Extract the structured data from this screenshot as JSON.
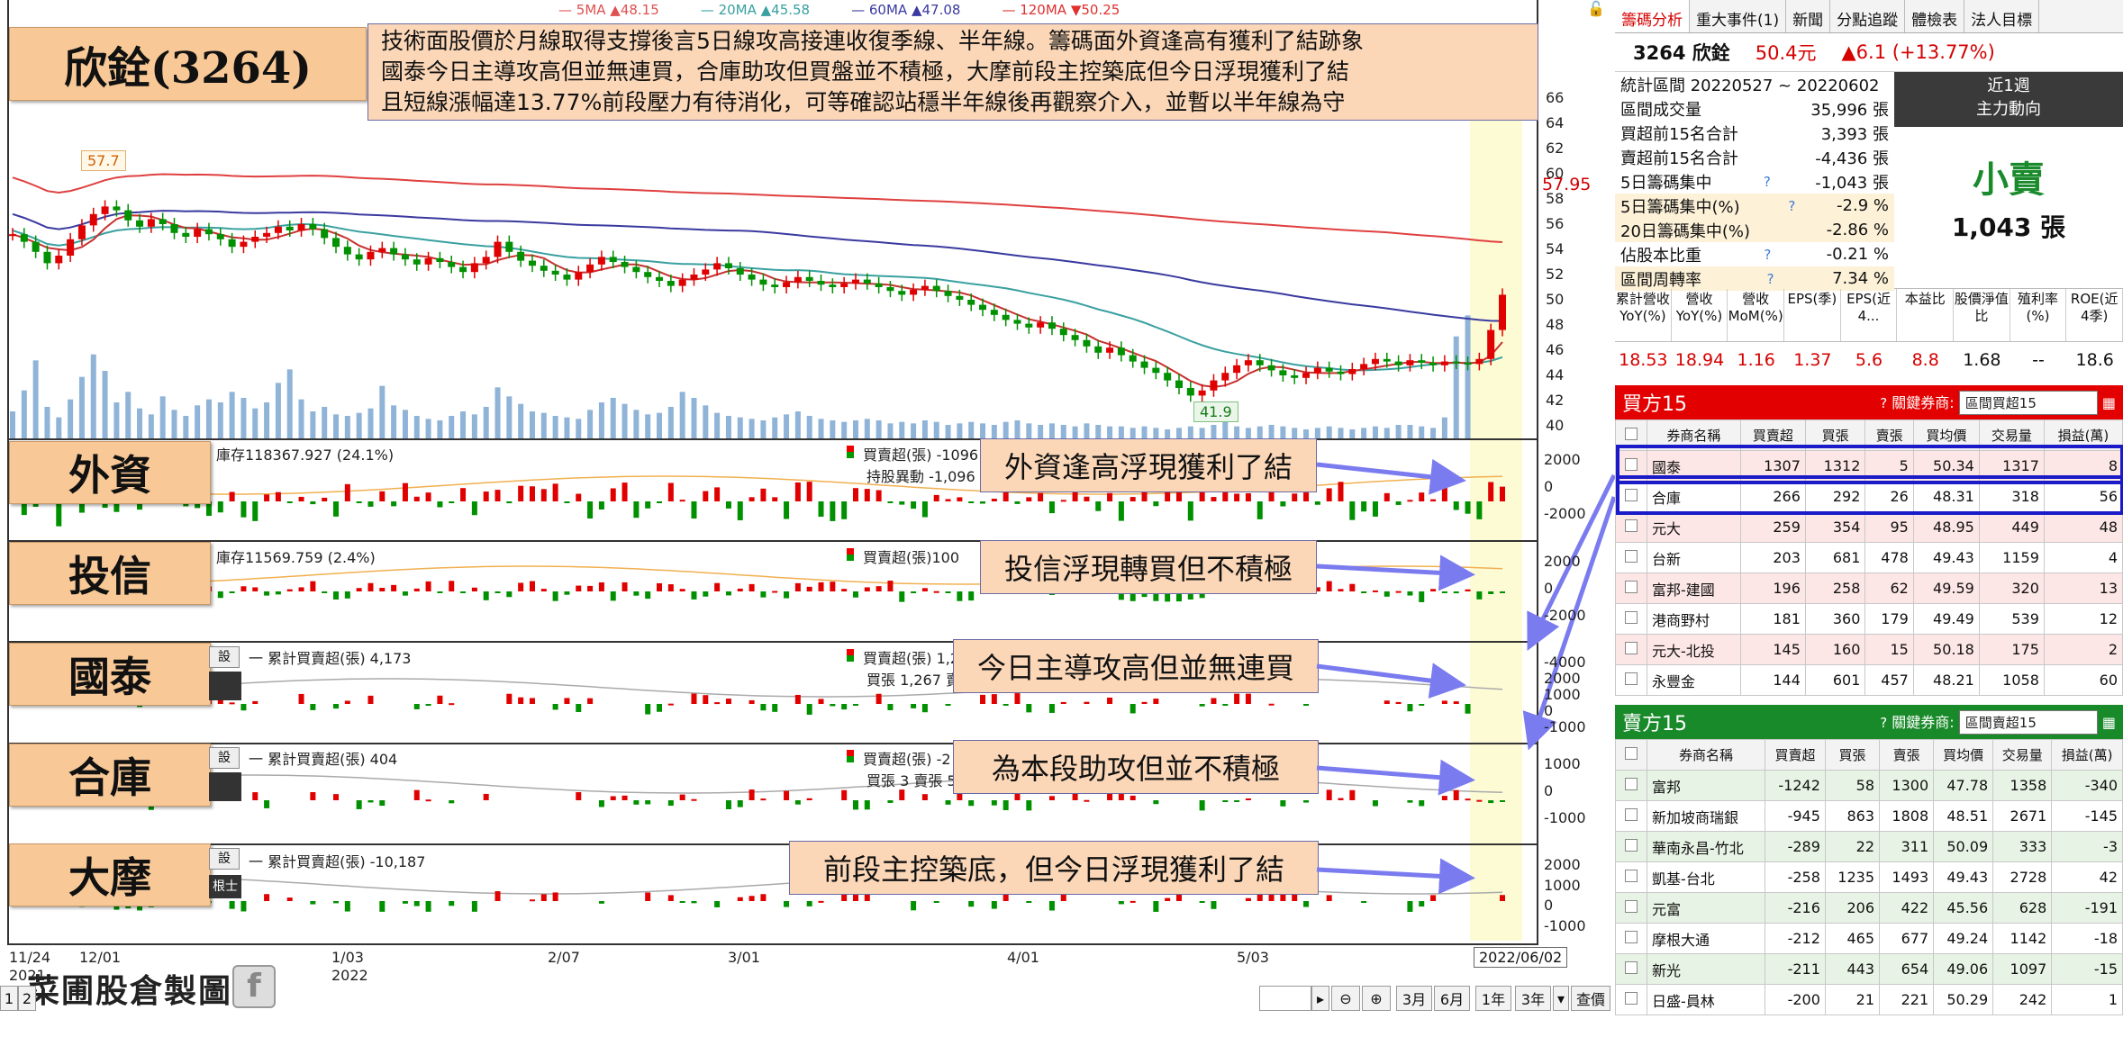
{
  "title": {
    "stock": "欣銓(3264)",
    "summary_lines": [
      "技術面股價於月線取得支撐後言5日線攻高接連收復季線、半年線。籌碼面外資逢高有獲利了結跡象",
      "國泰今日主導攻高但並無連買，合庫助攻但買盤並不積極，大摩前段主控築底但今日浮現獲利了結",
      "且短線漲幅達13.77%前段壓力有待消化，可等確認站穩半年線後再觀察介入，並暫以半年線為守"
    ]
  },
  "ma_legend": [
    {
      "label": "5MA ▲48.15",
      "color": "#e05050"
    },
    {
      "label": "20MA ▲45.58",
      "color": "#3aa0a0"
    },
    {
      "label": "60MA ▲47.08",
      "color": "#3a3aa0"
    },
    {
      "label": "120MA ▼50.25",
      "color": "#e03030"
    }
  ],
  "chart_data": {
    "type": "candlestick",
    "price_axis_ticks": [
      "66",
      "64",
      "62",
      "60",
      "58",
      "56",
      "54",
      "52",
      "50",
      "48",
      "46",
      "44",
      "42",
      "40"
    ],
    "last_price_label": "57.95",
    "high_marker": "57.7",
    "low_marker": "41.9",
    "date_ticks": [
      {
        "label": "11/24",
        "sub": "2021"
      },
      {
        "label": "12/01",
        "sub": ""
      },
      {
        "label": "1/03",
        "sub": "2022"
      },
      {
        "label": "2/07",
        "sub": ""
      },
      {
        "label": "3/01",
        "sub": ""
      },
      {
        "label": "4/01",
        "sub": ""
      },
      {
        "label": "5/03",
        "sub": ""
      }
    ],
    "current_date": "2022/06/02",
    "closes": [
      55.2,
      54.6,
      53.8,
      52.9,
      53.5,
      54.8,
      55.9,
      56.8,
      57.4,
      57.1,
      56.3,
      55.8,
      56.4,
      56.0,
      55.3,
      55.0,
      55.6,
      55.2,
      54.8,
      54.2,
      54.6,
      55.0,
      55.3,
      55.8,
      55.5,
      56.0,
      55.6,
      54.9,
      54.2,
      53.6,
      53.2,
      53.8,
      54.1,
      53.6,
      53.2,
      52.8,
      53.3,
      53.0,
      52.6,
      52.2,
      52.9,
      53.4,
      54.6,
      53.8,
      53.1,
      52.7,
      52.3,
      52.0,
      51.6,
      52.2,
      52.8,
      53.4,
      53.0,
      52.6,
      52.2,
      51.8,
      51.5,
      51.1,
      51.6,
      52.0,
      52.4,
      52.9,
      52.5,
      52.0,
      51.6,
      51.2,
      51.0,
      51.4,
      51.8,
      51.5,
      51.2,
      51.0,
      51.3,
      51.6,
      51.3,
      51.0,
      50.7,
      50.4,
      50.8,
      51.1,
      50.7,
      50.3,
      50.0,
      49.6,
      49.2,
      48.8,
      48.4,
      48.1,
      47.8,
      48.2,
      47.7,
      47.2,
      46.8,
      46.3,
      45.8,
      46.2,
      45.6,
      45.1,
      44.6,
      44.2,
      43.6,
      43.0,
      42.4,
      42.8,
      43.6,
      44.2,
      44.8,
      45.2,
      44.8,
      44.4,
      44.0,
      43.8,
      44.2,
      44.6,
      44.3,
      44.1,
      44.5,
      44.9,
      45.3,
      45.1,
      44.8,
      45.2,
      45.0,
      44.8,
      45.1,
      45.0,
      44.9,
      45.3,
      47.6,
      50.4
    ],
    "volumes": [
      1800,
      3200,
      5200,
      2100,
      1400,
      2600,
      4100,
      5600,
      4500,
      2400,
      3100,
      2000,
      1600,
      2800,
      1900,
      1500,
      2200,
      2600,
      2400,
      3100,
      2700,
      2000,
      2400,
      3700,
      4600,
      2600,
      1800,
      2100,
      1600,
      1500,
      1700,
      2000,
      3500,
      2200,
      1900,
      1500,
      1300,
      1200,
      1500,
      1800,
      1600,
      2100,
      3400,
      2800,
      2300,
      1800,
      1700,
      1500,
      1400,
      1300,
      1900,
      2400,
      2700,
      2300,
      1900,
      1600,
      1700,
      2100,
      3100,
      2700,
      2200,
      1700,
      1500,
      1400,
      1300,
      1200,
      1400,
      1600,
      1800,
      1500,
      1300,
      1200,
      1100,
      1200,
      1300,
      1200,
      1000,
      1100,
      1000,
      1200,
      1100,
      900,
      1000,
      1100,
      1000,
      900,
      1100,
      1200,
      1000,
      900,
      1000,
      900,
      800,
      1000,
      900,
      800,
      800,
      700,
      800,
      700,
      600,
      700,
      800,
      700,
      900,
      1100,
      800,
      700,
      800,
      900,
      800,
      700,
      600,
      700,
      800,
      700,
      600,
      700,
      800,
      700,
      900,
      900,
      800,
      700,
      1400,
      6800,
      8200
    ],
    "volume_ymax": 9000,
    "price_ymin": 39,
    "price_ymax": 67
  },
  "panels": [
    {
      "name": "外資",
      "label": "外資",
      "info_left": "庫存118367.927 (24.1%)",
      "info_mid1": "買賣超(張) -1096",
      "info_mid2": "持股異動 -1,096",
      "note": "外資逢高浮現獲利了結",
      "axis": [
        "2000",
        "0",
        "-2000"
      ]
    },
    {
      "name": "投信",
      "label": "投信",
      "info_left": "庫存11569.759 (2.4%)",
      "info_mid1": "買賣超(張)100",
      "info_mid2": "",
      "note": "投信浮現轉買但不積極",
      "axis": [
        "2000",
        "0",
        "-2000"
      ]
    },
    {
      "name": "國泰",
      "label": "國泰",
      "info_left": "一 累計買賣超(張) 4,173",
      "info_mid1": "買賣超(張) 1,2",
      "info_mid2": "買張 1,267 賣",
      "note": "今日主導攻高但並無連買",
      "axis": [
        "-4000",
        "2000",
        "1000",
        "0",
        "-1000"
      ]
    },
    {
      "name": "合庫",
      "label": "合庫",
      "info_left": "一 累計買賣超(張) 404",
      "info_mid1": "買賣超(張) -2",
      "info_mid2": "買張 3 賣張 5",
      "note": "為本段助攻但並不積極",
      "axis": [
        "1000",
        "0",
        "-1000"
      ]
    },
    {
      "name": "大摩",
      "label": "大摩",
      "info_left": "一 累計買賣超(張) -10,187",
      "info_mid1": "",
      "info_mid2": "",
      "note": "前段主控築底，但今日浮現獲利了結",
      "axis": [
        "2000",
        "1000",
        "0",
        "-1000"
      ]
    }
  ],
  "side_labels": {
    "button1": "設",
    "button2": "根士"
  },
  "footer": {
    "brand": "菜圃股倉製圖",
    "fb_icon": "f"
  },
  "toolbar": {
    "left_num": "1",
    "left_num2": "2",
    "buttons": [
      "3月",
      "6月",
      "1年",
      "3年",
      "查價"
    ]
  },
  "right": {
    "tabs": [
      "籌碼分析",
      "重大事件(1)",
      "新聞",
      "分點追蹤",
      "體檢表",
      "法人目標"
    ],
    "quote": {
      "name": "3264 欣銓",
      "price": "50.4元",
      "change": "▲6.1 (+13.77%)"
    },
    "stats_period": "統計區間 20220527 ~ 20220602",
    "stats": [
      {
        "label": "區間成交量",
        "value": "35,996 張",
        "hl": false,
        "q": false
      },
      {
        "label": "買超前15名合計",
        "value": "3,393 張",
        "hl": false,
        "q": false
      },
      {
        "label": "賣超前15名合計",
        "value": "-4,436 張",
        "hl": false,
        "q": false
      },
      {
        "label": "5日籌碼集中",
        "value": "-1,043 張",
        "hl": false,
        "q": true
      },
      {
        "label": "5日籌碼集中(%)",
        "value": "-2.9 %",
        "hl": true,
        "q": true
      },
      {
        "label": "20日籌碼集中(%)",
        "value": "-2.86 %",
        "hl": true,
        "q": false
      },
      {
        "label": "佔股本比重",
        "value": "-0.21 %",
        "hl": false,
        "q": true
      },
      {
        "label": "區間周轉率",
        "value": "7.34 %",
        "hl": true,
        "q": true
      }
    ],
    "main_force": {
      "period": "近1週",
      "title": "主力動向",
      "verdict": "小賣",
      "amount": "1,043 張"
    },
    "fin_headers": [
      "累計營收YoY(%)",
      "營收YoY(%)",
      "營收MoM(%)",
      "EPS(季)",
      "EPS(近4...",
      "本益比",
      "股價淨值比",
      "殖利率(%)",
      "ROE(近4季)"
    ],
    "fin_values": [
      "18.53",
      "18.94",
      "1.16",
      "1.37",
      "5.6",
      "8.8",
      "1.68",
      "--",
      "18.6"
    ],
    "buy_header": {
      "title": "買方15",
      "rel": "關鍵券商:",
      "select": "區間買超15"
    },
    "sell_header": {
      "title": "賣方15",
      "rel": "關鍵券商:",
      "select": "區間賣超15"
    },
    "table_cols": [
      "券商名稱",
      "買賣超",
      "買張",
      "賣張",
      "買均價",
      "交易量",
      "損益(萬)"
    ],
    "buy_rows": [
      [
        "國泰",
        "1307",
        "1312",
        "5",
        "50.34",
        "1317",
        "8"
      ],
      [
        "合庫",
        "266",
        "292",
        "26",
        "48.31",
        "318",
        "56"
      ],
      [
        "元大",
        "259",
        "354",
        "95",
        "48.95",
        "449",
        "48"
      ],
      [
        "台新",
        "203",
        "681",
        "478",
        "49.43",
        "1159",
        "4"
      ],
      [
        "富邦-建國",
        "196",
        "258",
        "62",
        "49.59",
        "320",
        "13"
      ],
      [
        "港商野村",
        "181",
        "360",
        "179",
        "49.49",
        "539",
        "12"
      ],
      [
        "元大-北投",
        "145",
        "160",
        "15",
        "50.18",
        "175",
        "2"
      ],
      [
        "永豐金",
        "144",
        "601",
        "457",
        "48.21",
        "1058",
        "60"
      ]
    ],
    "sell_rows": [
      [
        "富邦",
        "-1242",
        "58",
        "1300",
        "47.78",
        "1358",
        "-340"
      ],
      [
        "新加坡商瑞銀",
        "-945",
        "863",
        "1808",
        "48.51",
        "2671",
        "-145"
      ],
      [
        "華南永昌-竹北",
        "-289",
        "22",
        "311",
        "50.09",
        "333",
        "-3"
      ],
      [
        "凱基-台北",
        "-258",
        "1235",
        "1493",
        "49.43",
        "2728",
        "42"
      ],
      [
        "元富",
        "-216",
        "206",
        "422",
        "45.56",
        "628",
        "-191"
      ],
      [
        "摩根大通",
        "-212",
        "465",
        "677",
        "49.24",
        "1142",
        "-18"
      ],
      [
        "新光",
        "-211",
        "443",
        "654",
        "49.06",
        "1097",
        "-15"
      ],
      [
        "日盛-員林",
        "-200",
        "21",
        "221",
        "50.29",
        "242",
        "1"
      ]
    ]
  }
}
